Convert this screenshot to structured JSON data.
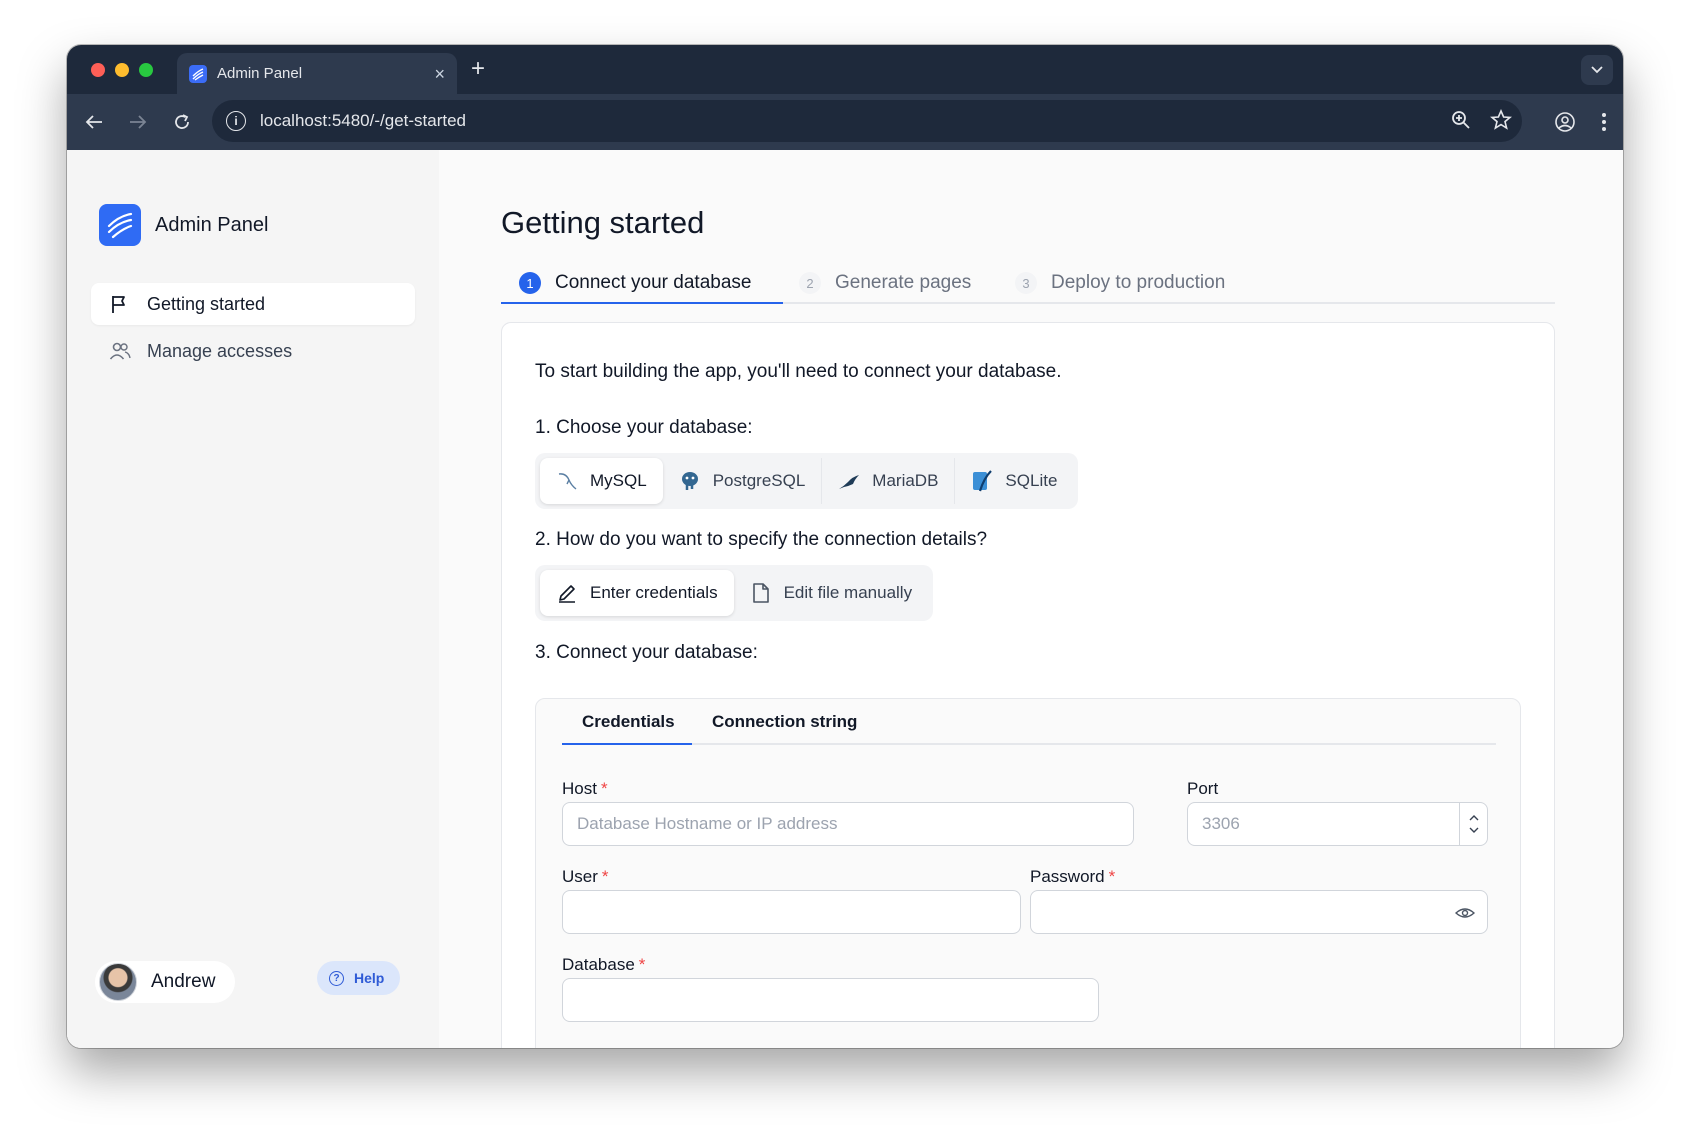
{
  "browser": {
    "tab_title": "Admin Panel",
    "url": "localhost:5480/-/get-started"
  },
  "sidebar": {
    "brand": "Admin Panel",
    "items": [
      {
        "label": "Getting started",
        "active": true
      },
      {
        "label": "Manage accesses",
        "active": false
      }
    ],
    "user": "Andrew",
    "help": "Help"
  },
  "main": {
    "title": "Getting started",
    "steps": [
      {
        "num": "1",
        "label": "Connect your database"
      },
      {
        "num": "2",
        "label": "Generate pages"
      },
      {
        "num": "3",
        "label": "Deploy to production"
      }
    ],
    "intro": "To start building the app, you'll need to connect your database.",
    "choose_label": "1. Choose your database:",
    "databases": [
      "MySQL",
      "PostgreSQL",
      "MariaDB",
      "SQLite"
    ],
    "selected_database": "MySQL",
    "specify_label": "2. How do you want to specify the connection details?",
    "methods": [
      "Enter credentials",
      "Edit file manually"
    ],
    "selected_method": "Enter credentials",
    "connect_label": "3. Connect your database:",
    "inner_tabs": [
      "Credentials",
      "Connection string"
    ],
    "fields": {
      "host_label": "Host",
      "host_placeholder": "Database Hostname or IP address",
      "port_label": "Port",
      "port_placeholder": "3306",
      "user_label": "User",
      "password_label": "Password",
      "database_label": "Database",
      "required_mark": "*"
    }
  },
  "colors": {
    "accent": "#2563eb",
    "required": "#ef4444",
    "chrome_dark": "#1e293b"
  }
}
